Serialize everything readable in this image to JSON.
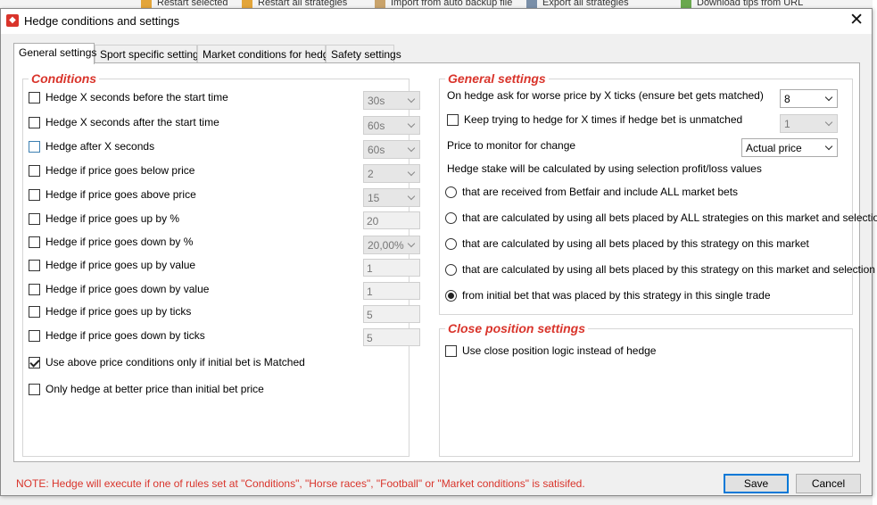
{
  "background": {
    "toolbar_items": [
      "Restart selected",
      "Restart all strategies",
      "Import from auto backup file",
      "Export all strategies",
      "Download tips from URL"
    ]
  },
  "window": {
    "title": "Hedge conditions and settings",
    "close_glyph": "✕"
  },
  "tabs": [
    {
      "label": "General settings",
      "active": true
    },
    {
      "label": "Sport specific settings",
      "active": false
    },
    {
      "label": "Market conditions for hedge",
      "active": false
    },
    {
      "label": "Safety settings",
      "active": false
    }
  ],
  "conditions": {
    "title": "Conditions",
    "rows": [
      {
        "label": "Hedge X seconds before the start time",
        "checked": false,
        "control": "combo",
        "value": "30s"
      },
      {
        "label": "Hedge X seconds after the start time",
        "checked": false,
        "control": "combo",
        "value": "60s"
      },
      {
        "label": "Hedge after X seconds",
        "checked": false,
        "control": "combo",
        "value": "60s"
      },
      {
        "label": "Hedge if price goes below price",
        "checked": false,
        "control": "combo",
        "value": "2"
      },
      {
        "label": "Hedge if price goes above price",
        "checked": false,
        "control": "combo",
        "value": "15"
      },
      {
        "label": "Hedge if price goes up by %",
        "checked": false,
        "control": "text",
        "value": "20"
      },
      {
        "label": "Hedge if price goes down by %",
        "checked": false,
        "control": "combo",
        "value": "20,00%"
      },
      {
        "label": "Hedge if price goes up by value",
        "checked": false,
        "control": "text",
        "value": "1"
      },
      {
        "label": "Hedge if price goes down by value",
        "checked": false,
        "control": "text",
        "value": "1"
      },
      {
        "label": "Hedge if price goes up by ticks",
        "checked": false,
        "control": "text",
        "value": "5"
      },
      {
        "label": "Hedge if price goes down by ticks",
        "checked": false,
        "control": "text",
        "value": "5"
      }
    ],
    "matched_only": {
      "label": "Use above price conditions only if initial bet is Matched",
      "checked": true
    },
    "better_price": {
      "label": "Only hedge at better price than initial bet price",
      "checked": false
    }
  },
  "general": {
    "title": "General settings",
    "worse_price_label": "On hedge ask for worse price by X ticks (ensure bet gets matched)",
    "worse_price_value": "8",
    "keep_trying_label": "Keep trying to hedge for X times if hedge bet is unmatched",
    "keep_trying_checked": false,
    "keep_trying_value": "1",
    "monitor_label": "Price to monitor for change",
    "monitor_value": "Actual price",
    "stake_label": "Hedge stake will be calculated by using selection profit/loss values",
    "options": [
      {
        "label": "that are received from Betfair and include ALL market bets",
        "selected": false
      },
      {
        "label": "that are calculated by using all bets placed by ALL strategies on this market and selection",
        "selected": false
      },
      {
        "label": "that are calculated by using all bets placed by this strategy on this market",
        "selected": false
      },
      {
        "label": "that are calculated by using all bets placed by this strategy on this market and selection",
        "selected": false
      },
      {
        "label": "from initial bet that was placed by this strategy in this single trade",
        "selected": true
      }
    ]
  },
  "close_position": {
    "title": "Close position settings",
    "label": "Use close position logic instead of hedge",
    "checked": false
  },
  "footer": {
    "note": "NOTE: Hedge will execute if one of rules set at \"Conditions\", \"Horse races\", \"Football\" or \"Market conditions\" is satisifed.",
    "save_label": "Save",
    "cancel_label": "Cancel"
  },
  "colors": {
    "accent_red": "#d9342b",
    "focus_blue": "#0078d7"
  }
}
